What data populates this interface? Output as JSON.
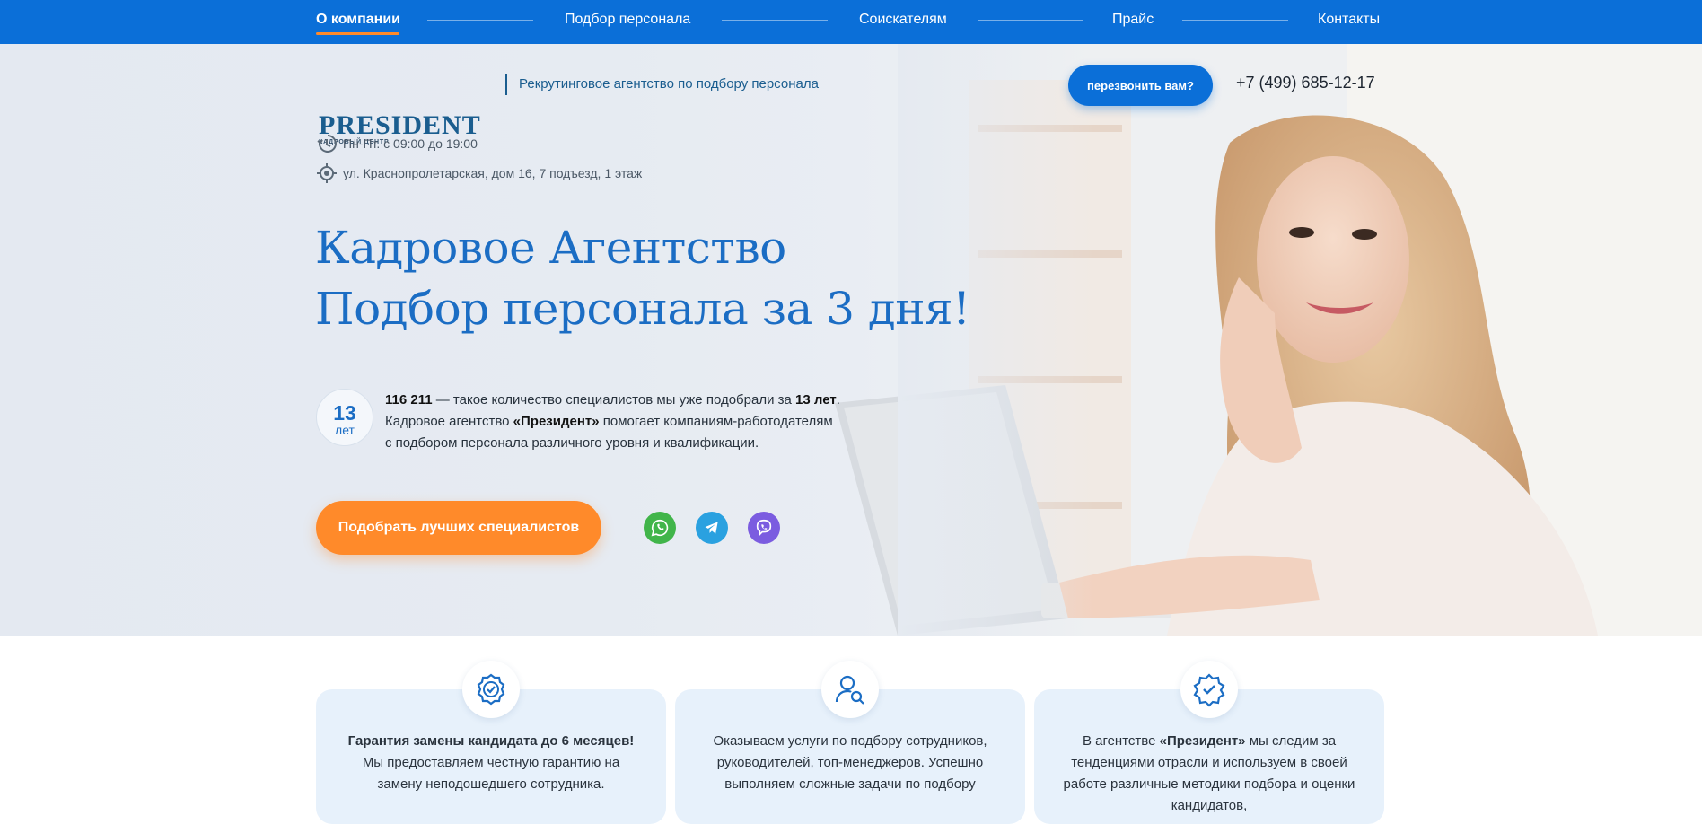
{
  "nav": {
    "items": [
      {
        "label": "О компании",
        "active": true
      },
      {
        "label": "Подбор персонала"
      },
      {
        "label": "Соискателям"
      },
      {
        "label": "Прайс"
      },
      {
        "label": "Контакты"
      }
    ]
  },
  "header": {
    "logo_main": "PRESIDENT",
    "logo_sub": "КАДРОВЫЙ ЦЕНТР",
    "tagline": "Рекрутинговое агентство по подбору персонала",
    "callback_label": "перезвонить вам?",
    "phone": "+7 (499) 685-12-17"
  },
  "info": {
    "hours": "Пн-Пт. с 09:00 до 19:00",
    "address": "ул. Краснопролетарская, дом 16, 7 подъезд, 1 этаж"
  },
  "hero": {
    "title_line1": "Кадровое Агентство",
    "title_line2": "Подбор персонала за 3 дня!",
    "badge_number": "13",
    "badge_unit": "лет",
    "desc_count": "116 211",
    "desc_part1": " — такое количество специалистов мы уже подобрали за ",
    "desc_years": "13 лет",
    "desc_part2": ".",
    "desc_part3": "Кадровое агентство ",
    "desc_brand": "«Президент»",
    "desc_part4": " помогает компаниям-работодателям",
    "desc_part5": "с подбором персонала различного уровня и квалификации.",
    "cta_label": "Подобрать лучших специалистов"
  },
  "social": [
    {
      "icon": "whatsapp-icon",
      "color": "#41b54a"
    },
    {
      "icon": "telegram-icon",
      "color": "#2aa1e0"
    },
    {
      "icon": "viber-icon",
      "color": "#7b5ce0"
    }
  ],
  "features": [
    {
      "icon": "award-badge-icon",
      "bold": "Гарантия замены кандидата до 6 месяцев!",
      "text": " Мы предоставляем честную гарантию на замену неподошедшего сотрудника."
    },
    {
      "icon": "user-search-icon",
      "text": "Оказываем услуги по подбору сотрудников, руководителей, топ-менеджеров. Успешно выполняем сложные задачи по подбору"
    },
    {
      "icon": "verified-badge-icon",
      "pre": "В агентстве ",
      "bold": "«Президент»",
      "text": " мы следим за тенденциями отрасли и используем в своей работе различные методики подбора и оценки кандидатов,"
    }
  ],
  "colors": {
    "primary": "#0b6fd8",
    "accent": "#ff8a2a",
    "heading": "#1b6dc4",
    "card_bg": "#e7f1fb"
  }
}
